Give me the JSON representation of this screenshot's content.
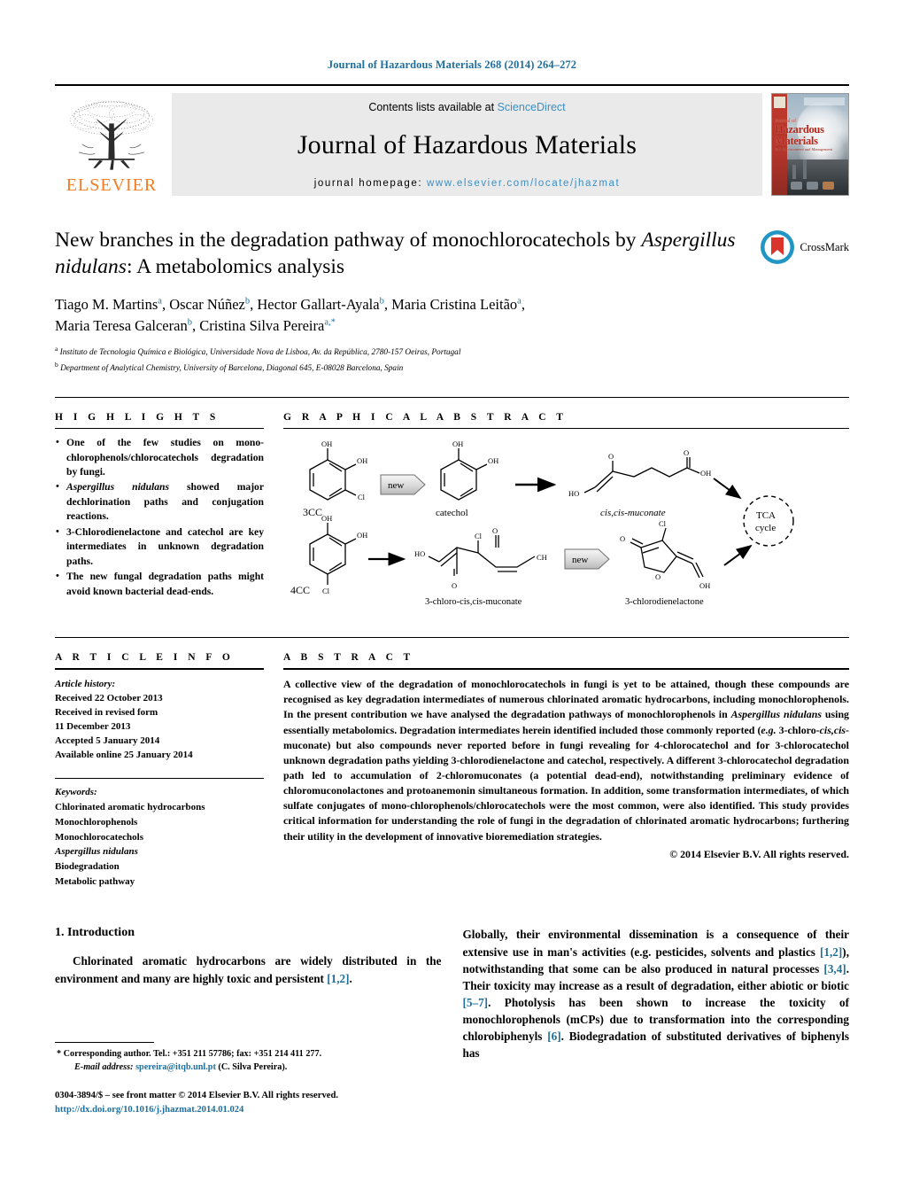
{
  "running_head": "Journal of Hazardous Materials 268 (2014) 264–272",
  "masthead": {
    "publisher_logo_text": "ELSEVIER",
    "contents_prefix": "Contents lists available at",
    "contents_link": "ScienceDirect",
    "journal_title": "Journal of Hazardous Materials",
    "homepage_prefix": "journal homepage:",
    "homepage_url": "www.elsevier.com/locate/jhazmat",
    "cover": {
      "line1": "Journal of",
      "line2": "Hazardous",
      "line3": "Materials",
      "line4": "Incl. Environment and Management"
    }
  },
  "article": {
    "title_line1": "New branches in the degradation pathway of monochlorocatechols by",
    "title_italic": "Aspergillus nidulans",
    "title_line2_rest": ": A metabolomics analysis",
    "crossmark_label": "CrossMark",
    "authors": [
      {
        "name": "Tiago M. Martins",
        "marks": "a",
        "sep": ", "
      },
      {
        "name": "Oscar Núñez",
        "marks": "b",
        "sep": ", "
      },
      {
        "name": "Hector Gallart-Ayala",
        "marks": "b",
        "sep": ", "
      },
      {
        "name": "Maria Cristina Leitão",
        "marks": "a",
        "sep": ","
      },
      {
        "name": "Maria Teresa Galceran",
        "marks": "b",
        "sep": ", "
      },
      {
        "name": "Cristina Silva Pereira",
        "marks": "a,*",
        "sep": ""
      }
    ],
    "affiliations": [
      {
        "mark": "a",
        "text": "Instituto de Tecnologia Química e Biológica, Universidade Nova de Lisboa, Av. da República, 2780-157 Oeiras, Portugal"
      },
      {
        "mark": "b",
        "text": "Department of Analytical Chemistry, University of Barcelona, Diagonal 645, E-08028 Barcelona, Spain"
      }
    ]
  },
  "sections": {
    "highlights_heading": "H I G H L I G H T S",
    "graphical_abstract_heading": "G R A P H I C A L   A B S T R A C T",
    "article_info_heading": "A R T I C L E   I N F O",
    "abstract_heading": "A B S T R A C T"
  },
  "highlights": [
    {
      "text_before": "One of the few studies on mono-chlorophenols/chlorocatechols degradation by fungi.",
      "italic": "",
      "text_after": ""
    },
    {
      "text_before": "",
      "italic": "Aspergillus nidulans",
      "text_after": " showed major dechlorination paths and conjugation reactions."
    },
    {
      "text_before": "3-Chlorodienelactone and catechol are key intermediates in unknown degradation paths.",
      "italic": "",
      "text_after": ""
    },
    {
      "text_before": "The new fungal degradation paths might avoid known bacterial dead-ends.",
      "italic": "",
      "text_after": ""
    }
  ],
  "graphical_abstract": {
    "labels": {
      "substrate_3cc": "3CC",
      "catechol": "catechol",
      "muconate": "cis,cis-muconate",
      "substrate_4cc": "4CC",
      "chloromuconate": "3-chloro-cis,cis-muconate",
      "chlorodienelactone": "3-chlorodienelactone",
      "tca_line1": "TCA",
      "tca_line2": "cycle",
      "new_badge": "new",
      "oh": "OH",
      "cl": "Cl",
      "ho": "HO",
      "o": "O",
      "ch": "CH"
    }
  },
  "article_info": {
    "history_label": "Article history:",
    "history": [
      "Received 22 October 2013",
      "Received in revised form",
      "11 December 2013",
      "Accepted 5 January 2014",
      "Available online 25 January 2014"
    ],
    "keywords_label": "Keywords:",
    "keywords": [
      {
        "text": "Chlorinated aromatic hydrocarbons",
        "italic": false
      },
      {
        "text": "Monochlorophenols",
        "italic": false
      },
      {
        "text": "Monochlorocatechols",
        "italic": false
      },
      {
        "text": "Aspergillus nidulans",
        "italic": true
      },
      {
        "text": "Biodegradation",
        "italic": false
      },
      {
        "text": "Metabolic pathway",
        "italic": false
      }
    ]
  },
  "abstract": {
    "p1_a": "A collective view of the degradation of monochlorocatechols in fungi is yet to be attained, though these compounds are recognised as key degradation intermediates of numerous chlorinated aromatic hydrocarbons, including monochlorophenols. In the present contribution we have analysed the degradation pathways of monochlorophenols in ",
    "p1_italic1": "Aspergillus nidulans",
    "p1_b": " using essentially metabolomics. Degradation intermediates herein identified included those commonly reported (",
    "p1_italic2": "e.g.",
    "p1_c": " 3-chloro-",
    "p1_italic3": "cis,cis",
    "p1_d": "-muconate) but also compounds never reported before in fungi revealing for 4-chlorocatechol and for 3-chlorocatechol unknown degradation paths yielding 3-chlorodienelactone and catechol, respectively. A different 3-chlorocatechol degradation path led to accumulation of 2-chloromuconates (a potential dead-end), notwithstanding preliminary evidence of chloromuconolactones and protoanemonin simultaneous formation. In addition, some transformation intermediates, of which sulfate conjugates of mono-chlorophenols/chlorocatechols were the most common, were also identified. This study provides critical information for understanding the role of fungi in the degradation of chlorinated aromatic hydrocarbons; furthering their utility in the development of innovative bioremediation strategies.",
    "copyright": "© 2014 Elsevier B.V. All rights reserved."
  },
  "body": {
    "intro_heading": "1.  Introduction",
    "left_p1_a": "Chlorinated aromatic hydrocarbons are widely distributed in the environment and many are highly toxic and persistent ",
    "left_p1_ref": "[1,2]",
    "left_p1_b": ".",
    "right_p1_a": "Globally, their environmental dissemination is a consequence of their extensive use in man's activities (",
    "right_p1_italic": "e.g.",
    "right_p1_b": " pesticides, solvents and plastics ",
    "right_p1_ref1": "[1,2]",
    "right_p1_c": "), notwithstanding that some can be also produced in natural processes ",
    "right_p1_ref2": "[3,4]",
    "right_p1_d": ". Their toxicity may increase as a result of degradation, either abiotic or biotic ",
    "right_p1_ref3": "[5–7]",
    "right_p1_e": ". Photolysis has been shown to increase the toxicity of monochlorophenols (mCPs) due to transformation into the corresponding chlorobiphenyls ",
    "right_p1_ref4": "[6]",
    "right_p1_f": ". Biodegradation of substituted derivatives of biphenyls has"
  },
  "footnotes": {
    "corresponding_mark": "*",
    "corresponding_text": "Corresponding author. Tel.: +351 211 57786; fax: +351 214 411 277.",
    "email_label": "E-mail address:",
    "email": "spereira@itqb.unl.pt",
    "email_owner": "(C. Silva Pereira).",
    "issn_line": "0304-3894/$ – see front matter © 2014 Elsevier B.V. All rights reserved.",
    "doi": "http://dx.doi.org/10.1016/j.jhazmat.2014.01.024"
  },
  "colors": {
    "link_blue": "#1f6f9c",
    "sciencedirect_blue": "#3a8fc4",
    "elsevier_orange": "#f47c20",
    "cover_red": "#c0392b",
    "crossmark_ring": "#2196c4",
    "crossmark_red": "#d9352b"
  }
}
